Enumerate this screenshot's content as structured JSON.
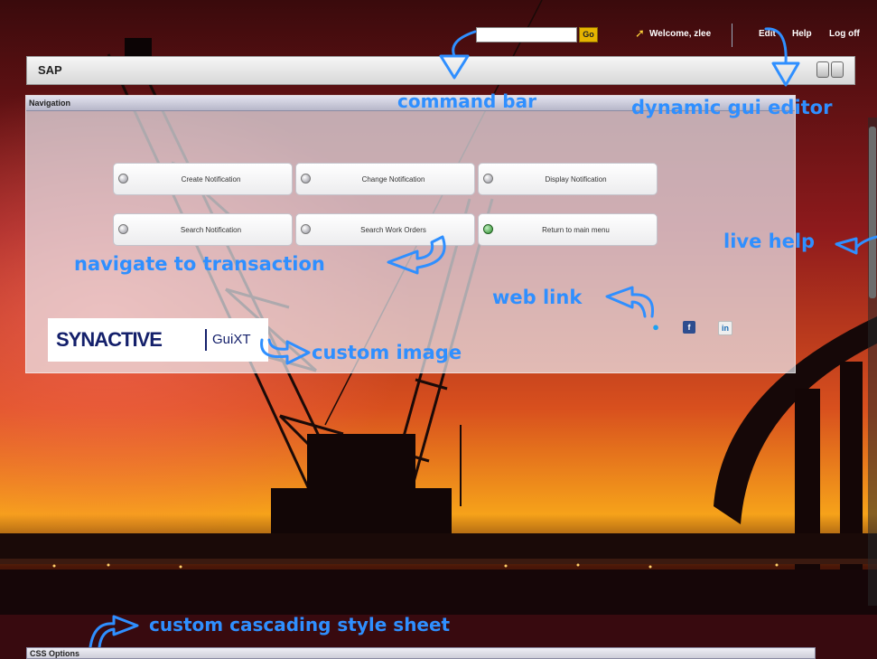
{
  "topbar": {
    "command_value": "",
    "go_label": "Go",
    "welcome": "Welcome, zlee",
    "links": [
      "Edit",
      "Help",
      "Log off"
    ]
  },
  "sap_bar": {
    "title": "SAP"
  },
  "navigation": {
    "header": "Navigation",
    "buttons": [
      {
        "label": "Create Notification",
        "icon": "gray-circle-icon"
      },
      {
        "label": "Change Notification",
        "icon": "gray-circle-icon"
      },
      {
        "label": "Display Notification",
        "icon": "gray-circle-icon"
      },
      {
        "label": "Search Notification",
        "icon": "gray-circle-icon"
      },
      {
        "label": "Search Work Orders",
        "icon": "gray-circle-icon"
      },
      {
        "label": "Return to main menu",
        "icon": "green-circle-icon"
      }
    ],
    "logo": {
      "main": "SYNACTIVE",
      "sub": "GuiXT"
    },
    "social": [
      "twitter-icon",
      "facebook-icon",
      "linkedin-icon"
    ]
  },
  "annotations": {
    "command_bar": "command bar",
    "dynamic_gui_editor": "dynamic gui editor",
    "navigate_to_transaction": "navigate to transaction",
    "live_help": "live help",
    "web_link": "web link",
    "custom_image": "custom image",
    "custom_css": "custom cascading style sheet"
  },
  "css_options": {
    "header": "CSS Options"
  },
  "colors": {
    "annotation": "#2f8fff",
    "go_button": "#e6b400",
    "logo_navy": "#14206b",
    "sky_top": "#3a0a0c",
    "sky_glow": "#f6a21a"
  }
}
